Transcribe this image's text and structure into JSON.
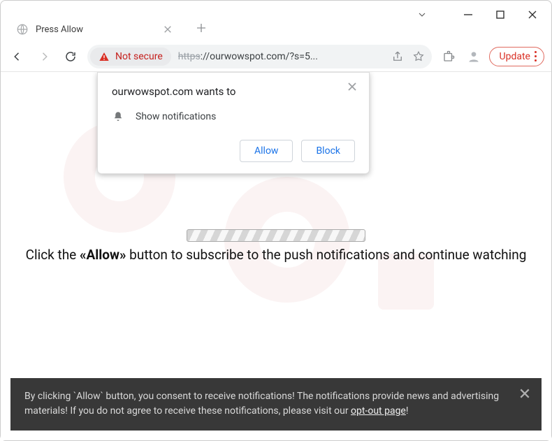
{
  "window": {
    "tab_title": "Press Allow"
  },
  "toolbar": {
    "secure_label": "Not secure",
    "url_scheme": "https",
    "url_rest": "://ourwowspot.com/?s=5...",
    "update_label": "Update"
  },
  "permission": {
    "origin": "ourwowspot.com wants to",
    "item": "Show notifications",
    "allow": "Allow",
    "block": "Block"
  },
  "page": {
    "instruction_pre": "Click the ",
    "instruction_bold": "«Allow»",
    "instruction_post": " button to subscribe to the push notifications and continue watching"
  },
  "consent": {
    "text_pre": "By clicking `Allow` button, you consent to receive notifications! The notifications provide news and advertising materials! If you do not agree to receive these notifications, please visit our ",
    "link": "opt-out page",
    "text_post": "!"
  }
}
